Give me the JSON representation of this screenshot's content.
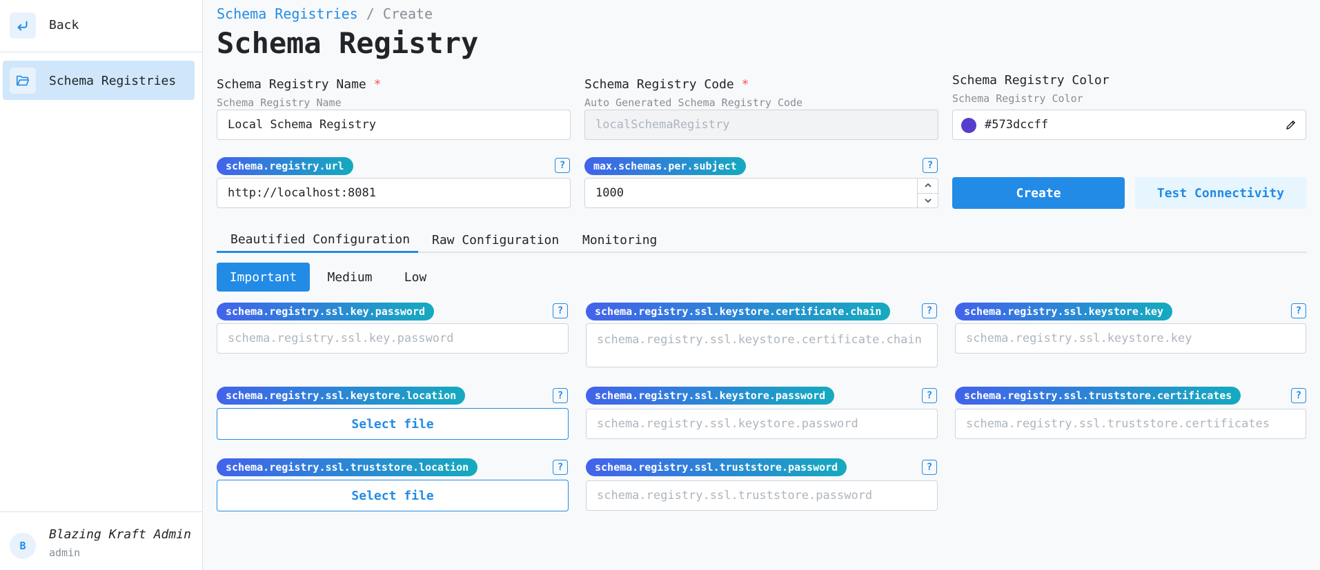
{
  "sidebar": {
    "back_label": "Back",
    "nav_items": [
      {
        "label": "Schema Registries",
        "icon": "folder-icon"
      }
    ],
    "user": {
      "initial": "B",
      "name": "Blazing Kraft Admin",
      "role": "admin"
    }
  },
  "breadcrumb": {
    "link": "Schema Registries",
    "separator": "/",
    "current": "Create"
  },
  "page_title": "Schema Registry",
  "form": {
    "name": {
      "label": "Schema Registry Name",
      "required": "*",
      "description": "Schema Registry Name",
      "value": "Local Schema Registry"
    },
    "code": {
      "label": "Schema Registry Code",
      "required": "*",
      "description": "Auto Generated Schema Registry Code",
      "value": "localSchemaRegistry"
    },
    "color": {
      "label": "Schema Registry Color",
      "description": "Schema Registry Color",
      "value": "#573dccff",
      "swatch": "#573dcc"
    },
    "url": {
      "tag": "schema.registry.url",
      "value": "http://localhost:8081"
    },
    "max_schemas": {
      "tag": "max.schemas.per.subject",
      "value": "1000"
    },
    "help_glyph": "?"
  },
  "actions": {
    "create": "Create",
    "test": "Test Connectivity"
  },
  "tabs": [
    "Beautified Configuration",
    "Raw Configuration",
    "Monitoring"
  ],
  "segments": [
    "Important",
    "Medium",
    "Low"
  ],
  "config": {
    "ssl_key_password": {
      "tag": "schema.registry.ssl.key.password",
      "placeholder": "schema.registry.ssl.key.password"
    },
    "ssl_keystore_certificate_chain": {
      "tag": "schema.registry.ssl.keystore.certificate.chain",
      "placeholder": "schema.registry.ssl.keystore.certificate.chain"
    },
    "ssl_keystore_key": {
      "tag": "schema.registry.ssl.keystore.key",
      "placeholder": "schema.registry.ssl.keystore.key"
    },
    "ssl_keystore_location": {
      "tag": "schema.registry.ssl.keystore.location",
      "button": "Select file"
    },
    "ssl_keystore_password": {
      "tag": "schema.registry.ssl.keystore.password",
      "placeholder": "schema.registry.ssl.keystore.password"
    },
    "ssl_truststore_certificates": {
      "tag": "schema.registry.ssl.truststore.certificates",
      "placeholder": "schema.registry.ssl.truststore.certificates"
    },
    "ssl_truststore_location": {
      "tag": "schema.registry.ssl.truststore.location",
      "button": "Select file"
    },
    "ssl_truststore_password": {
      "tag": "schema.registry.ssl.truststore.password",
      "placeholder": "schema.registry.ssl.truststore.password"
    }
  },
  "colors": {
    "accent": "#228be6",
    "pill_start": "#4263eb",
    "pill_end": "#15aabf",
    "active_nav": "#d0e7fb"
  }
}
